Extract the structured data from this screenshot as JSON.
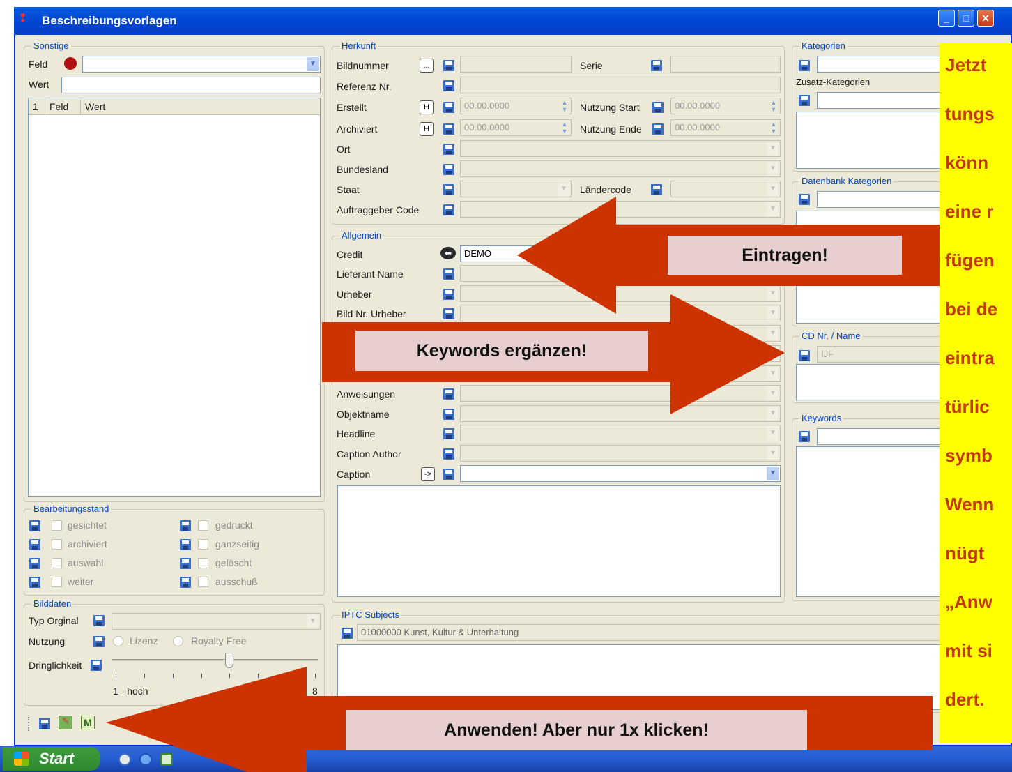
{
  "window": {
    "title": "Beschreibungsvorlagen",
    "controls": [
      "minimize",
      "maximize",
      "close"
    ]
  },
  "sonstige": {
    "legend": "Sonstige",
    "feld_label": "Feld",
    "wert_label": "Wert",
    "table_headers": [
      "1",
      "Feld",
      "Wert"
    ]
  },
  "bearbeitungsstand": {
    "legend": "Bearbeitungsstand",
    "left": [
      "gesichtet",
      "archiviert",
      "auswahl",
      "weiter"
    ],
    "right": [
      "gedruckt",
      "ganzseitig",
      "gelöscht",
      "ausschuß"
    ]
  },
  "bilddaten": {
    "legend": "Bilddaten",
    "typ_label": "Typ Orginal",
    "nutzung_label": "Nutzung",
    "lizenz": "Lizenz",
    "royalty": "Royalty Free",
    "dringlichkeit_label": "Dringlichkeit",
    "slider_min": "1 - hoch",
    "slider_max": "8",
    "slider_value": 5
  },
  "herkunft": {
    "legend": "Herkunft",
    "bildnummer": "Bildnummer",
    "serie": "Serie",
    "referenz": "Referenz Nr.",
    "erstellt": "Erstellt",
    "archiviert": "Archiviert",
    "date_placeholder": "00.00.0000",
    "nutzung_start": "Nutzung Start",
    "nutzung_ende": "Nutzung Ende",
    "ort": "Ort",
    "bundesland": "Bundesland",
    "staat": "Staat",
    "laendercode": "Ländercode",
    "auftraggeber": "Auftraggeber Code",
    "h_button": "H",
    "dots_button": "..."
  },
  "allgemein": {
    "legend": "Allgemein",
    "credit": "Credit",
    "credit_value": "DEMO",
    "lieferant": "Lieferant Name",
    "urheber": "Urheber",
    "bild_nr_urheber": "Bild Nr. Urheber",
    "anweisungen": "Anweisungen",
    "objektname": "Objektname",
    "headline": "Headline",
    "caption_author": "Caption Author",
    "caption": "Caption",
    "arrow_button": "->"
  },
  "iptc": {
    "legend": "IPTC Subjects",
    "value": "01000000 Kunst, Kultur & Unterhaltung"
  },
  "right_panel": {
    "kategorien": "Kategorien",
    "zusatz": "Zusatz-Kategorien",
    "datenbank": "Datenbank Kategorien",
    "cd": "CD Nr. / Name",
    "cd_value": "IJF",
    "keywords": "Keywords"
  },
  "callouts": {
    "eintragen": "Eintragen!",
    "keywords": "Keywords ergänzen!",
    "anwenden": "Anwenden! Aber nur 1x klicken!"
  },
  "side_text": [
    "Jetzt",
    "tungs",
    "könn",
    "eine r",
    "fügen",
    "bei de",
    "eintra",
    "türlic",
    "symb",
    "Wenn",
    "nügt",
    "„Anw",
    "mit si",
    "dert."
  ],
  "taskbar": {
    "start_label": "Start"
  },
  "colors": {
    "arrow": "#cc3300",
    "callout_bg": "#e8cfcf",
    "side_bg": "#ffff00",
    "side_text": "#c33a07",
    "xp_blue": "#0046d5"
  }
}
